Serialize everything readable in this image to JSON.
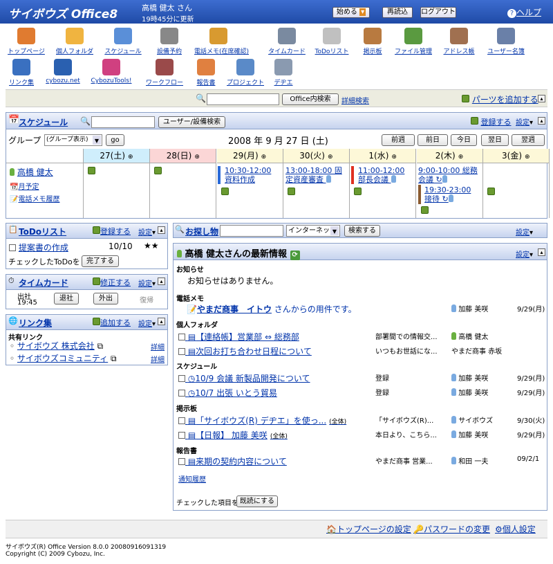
{
  "header": {
    "logo": "サイボウズ Office8",
    "user": "高橋 健太 さん",
    "updated": "19時45分に更新",
    "start": "始める",
    "reload": "再読込",
    "logout": "ログアウト",
    "help": "ヘルプ"
  },
  "apps": [
    {
      "label": "トップページ",
      "icon": "home-icon",
      "color": "#e07b30"
    },
    {
      "label": "個人フォルダ",
      "icon": "folder-icon",
      "color": "#f0b440"
    },
    {
      "label": "スケジュール",
      "icon": "calendar-icon",
      "color": "#5a8fd8"
    },
    {
      "label": "設備予約",
      "icon": "facility-icon",
      "color": "#888888"
    },
    {
      "label": "電話メモ(在席確認)",
      "icon": "phone-memo-icon",
      "color": "#d89a30"
    },
    {
      "label": "タイムカード",
      "icon": "timecard-icon",
      "color": "#7a8aa0"
    },
    {
      "label": "ToDoリスト",
      "icon": "todo-icon",
      "color": "#c0c0c0"
    },
    {
      "label": "掲示板",
      "icon": "board-icon",
      "color": "#b87a40"
    },
    {
      "label": "ファイル管理",
      "icon": "file-icon",
      "color": "#5a9a40"
    },
    {
      "label": "アドレス帳",
      "icon": "address-book-icon",
      "color": "#a07050"
    },
    {
      "label": "ユーザー名簿",
      "icon": "user-list-icon",
      "color": "#6a80a8"
    },
    {
      "label": "リンク集",
      "icon": "link-icon",
      "color": "#3a70c0"
    },
    {
      "label": "cybozu.net",
      "icon": "cybozu-net-icon",
      "color": "#2a60b0"
    },
    {
      "label": "CybozuTools!",
      "icon": "tools-icon",
      "color": "#d04080"
    },
    {
      "label": "ワークフロー",
      "icon": "workflow-icon",
      "color": "#9a4a4a"
    },
    {
      "label": "報告書",
      "icon": "report-icon",
      "color": "#e08040"
    },
    {
      "label": "プロジェクト",
      "icon": "project-icon",
      "color": "#5a8ac8"
    },
    {
      "label": "デヂエ",
      "icon": "dezie-icon",
      "color": "#8a9ab0"
    }
  ],
  "search": {
    "button": "Office内検索",
    "detail": "詳細検索",
    "add_parts": "パーツを追加する"
  },
  "schedule": {
    "title": "スケジュール",
    "user_search": "ユーザー/設備検索",
    "register": "登録する",
    "settings": "設定",
    "group_label": "グループ",
    "group_value": "(グループ表示)",
    "go": "go",
    "date": "2008 年 9 月 27 日 (土)",
    "nav": [
      "前週",
      "前日",
      "今日",
      "翌日",
      "翌週"
    ],
    "days": [
      {
        "label": "27(土)",
        "bg": "#cfeefc"
      },
      {
        "label": "28(日)",
        "bg": "#fbd6d6"
      },
      {
        "label": "29(月)",
        "bg": "#fdf8d8"
      },
      {
        "label": "30(火)",
        "bg": "#fdf8d8"
      },
      {
        "label": "1(水)",
        "bg": "#fdf8d8"
      },
      {
        "label": "2(木)",
        "bg": "#fdf8d8"
      },
      {
        "label": "3(金)",
        "bg": "#fdf8d8"
      }
    ],
    "user": "高橋 健太",
    "monthly": "月予定",
    "phone_hist": "電話メモ履歴",
    "events": [
      {
        "text": "10:30-12:00 資料作成",
        "color": "#2a6ad8"
      },
      {
        "text": "13:00-18:00 固定資産審査",
        "color": "#ffffff"
      },
      {
        "text": "11:00-12:00 部長会議",
        "color": "#e03020"
      },
      {
        "text": "9:00-10:00 総務会議",
        "color": "#ffffff"
      },
      {
        "text": "19:30-23:00 接待",
        "color": "#8a5a30"
      }
    ]
  },
  "todo": {
    "title": "ToDoリスト",
    "register": "登録する",
    "settings": "設定",
    "item": "提案書の作成",
    "date": "10/10",
    "stars": "★★",
    "checked": "チェックしたToDoを",
    "done": "完了する"
  },
  "timecard": {
    "title": "タイムカード",
    "edit": "修正する",
    "settings": "設定",
    "in_label": "出社",
    "in_time": "19:45",
    "leave": "退社",
    "out": "外出",
    "back": "復帰"
  },
  "links": {
    "title": "リンク集",
    "add": "追加する",
    "settings": "設定",
    "shared": "共有リンク",
    "items": [
      {
        "label": "サイボウズ 株式会社",
        "detail": "詳細"
      },
      {
        "label": "サイボウズコミュニティ",
        "detail": "詳細"
      }
    ]
  },
  "find": {
    "title": "お探し物",
    "scope": "インターネット",
    "button": "検索する",
    "settings": "設定"
  },
  "latest": {
    "title": "高橋 健太さんの最新情報",
    "settings": "設定",
    "notice_label": "お知らせ",
    "notice": "お知らせはありません。",
    "phone_label": "電話メモ",
    "phone": {
      "link": "やまだ商事　イトウ",
      "rest": " さんからの用件です。",
      "person": "加藤 美咲",
      "date": "9/29(月)"
    },
    "folder_label": "個人フォルダ",
    "folder": [
      {
        "title": "【連絡帳】営業部 ⇔ 総務部",
        "snip": "部署間での情報交...",
        "person": "高橋 健太",
        "date": ""
      },
      {
        "title": "次回お打ち合わせ日程について",
        "snip": "いつもお世話にな...",
        "person": "やまだ商事 赤坂",
        "date": ""
      }
    ],
    "sched_label": "スケジュール",
    "sched": [
      {
        "title": "10/9 会議 新製品開発について",
        "snip": "登録",
        "person": "加藤 美咲",
        "date": "9/29(月)"
      },
      {
        "title": "10/7 出張 いとう貿易",
        "snip": "登録",
        "person": "加藤 美咲",
        "date": "9/29(月)"
      }
    ],
    "board_label": "掲示板",
    "board": [
      {
        "title": "「サイボウズ(R) デヂエ」を使っ...",
        "tag": "(全体)",
        "snip": "「サイボウズ(R)...",
        "person": "サイボウズ",
        "date": "9/30(火)"
      },
      {
        "title": "【日報】 加藤 美咲",
        "tag": "(全体)",
        "snip": "本日より、こちら...",
        "person": "加藤 美咲",
        "date": "9/29(月)"
      }
    ],
    "report_label": "報告書",
    "report": [
      {
        "title": "来期の契約内容について",
        "snip": "やまだ商事 営業...",
        "person": "和田 一夫",
        "date": "09/2/1"
      }
    ],
    "history": "通知履歴",
    "checked": "チェックした項目を",
    "mark_read": "既読にする"
  },
  "footer": {
    "top_settings": "トップページの設定",
    "password": "パスワードの変更",
    "personal": "個人設定",
    "version": "サイボウズ(R) Office Version 8.0.0 20080916091319",
    "copyright": "Copyright (C) 2009 Cybozu, Inc."
  }
}
